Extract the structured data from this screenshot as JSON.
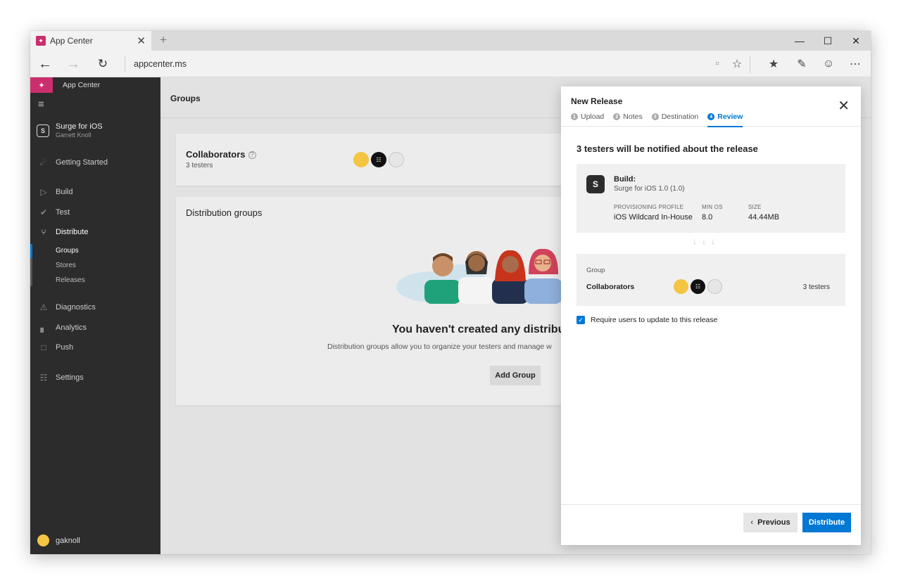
{
  "browser": {
    "tab_title": "App Center",
    "url": "appcenter.ms",
    "app_logo": "App Center logo"
  },
  "sidebar": {
    "brand": "App Center",
    "app": {
      "name": "Surge for iOS",
      "owner": "Garrett Knoll"
    },
    "items": [
      {
        "label": "Getting Started",
        "icon": "rocket-icon"
      },
      {
        "label": "Build",
        "icon": "play-icon"
      },
      {
        "label": "Test",
        "icon": "check-circle-icon"
      },
      {
        "label": "Distribute",
        "icon": "distribute-icon"
      },
      {
        "label": "Diagnostics",
        "icon": "warning-icon"
      },
      {
        "label": "Analytics",
        "icon": "bar-chart-icon"
      },
      {
        "label": "Push",
        "icon": "push-icon"
      },
      {
        "label": "Settings",
        "icon": "sliders-icon"
      }
    ],
    "distribute_sub": [
      "Groups",
      "Stores",
      "Releases"
    ],
    "user": "gaknoll"
  },
  "main": {
    "page_title": "Groups",
    "collaborators": {
      "title": "Collaborators",
      "subtitle": "3 testers"
    },
    "distribution_groups_title": "Distribution groups",
    "empty_title": "You haven't created any distribut",
    "empty_desc": "Distribution groups allow you to organize your testers and manage w",
    "add_group": "Add Group"
  },
  "panel": {
    "title": "New Release",
    "steps": [
      {
        "num": "1",
        "label": "Upload"
      },
      {
        "num": "2",
        "label": "Notes"
      },
      {
        "num": "3",
        "label": "Destination"
      },
      {
        "num": "4",
        "label": "Review"
      }
    ],
    "heading": "3 testers will be notified about the release",
    "build": {
      "label": "Build:",
      "name": "Surge for iOS 1.0 (1.0)",
      "profile_label": "PROVISIONING PROFILE",
      "profile_value": "iOS Wildcard In-House",
      "minos_label": "MIN OS",
      "minos_value": "8.0",
      "size_label": "SIZE",
      "size_value": "44.44MB"
    },
    "group": {
      "label": "Group",
      "name": "Collaborators",
      "count": "3 testers"
    },
    "require_update": {
      "label": "Require users to update to this release",
      "checked": true
    },
    "previous": "Previous",
    "distribute": "Distribute"
  },
  "colors": {
    "accent": "#0078d4",
    "brand": "#cb2e6d",
    "sidebar": "#2c2c2c"
  }
}
